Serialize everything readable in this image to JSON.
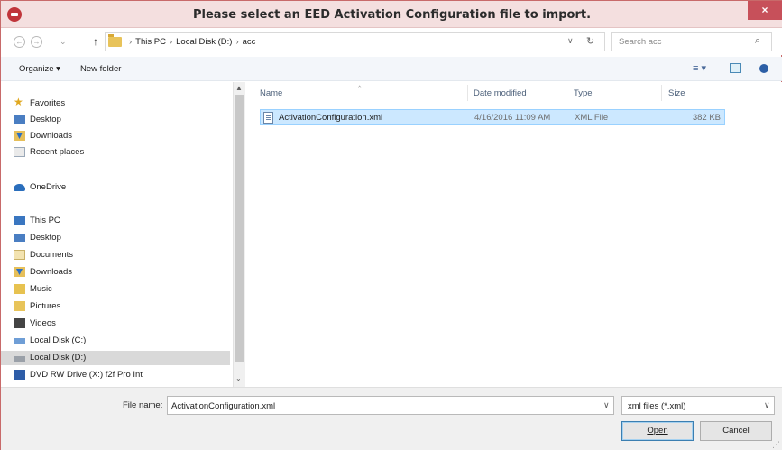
{
  "window": {
    "title": "Please select an EED Activation Configuration file to import.",
    "close_glyph": "×"
  },
  "nav": {
    "back_glyph": "←",
    "forward_glyph": "→",
    "recent_glyph": "⌄",
    "up_glyph": "↑",
    "breadcrumb": [
      "This PC",
      "Local Disk (D:)",
      "acc"
    ],
    "address_dropdown_glyph": "∨",
    "refresh_glyph": "↻",
    "search_placeholder": "Search acc",
    "search_glyph": "⌕"
  },
  "toolbar": {
    "organize_label": "Organize ▾",
    "new_folder_label": "New folder",
    "view_glyph": "≡ ▾"
  },
  "sidebar": {
    "favorites": {
      "label": "Favorites",
      "icon": "star-icon"
    },
    "favorite_items": [
      {
        "label": "Desktop",
        "icon": "desktop-icon"
      },
      {
        "label": "Downloads",
        "icon": "downloads-icon"
      },
      {
        "label": "Recent places",
        "icon": "recent-places-icon"
      }
    ],
    "onedrive": {
      "label": "OneDrive",
      "icon": "onedrive-icon"
    },
    "thispc": {
      "label": "This PC",
      "icon": "computer-icon"
    },
    "pc_items": [
      {
        "label": "Desktop",
        "icon": "desktop-icon"
      },
      {
        "label": "Documents",
        "icon": "documents-icon"
      },
      {
        "label": "Downloads",
        "icon": "downloads-icon"
      },
      {
        "label": "Music",
        "icon": "music-icon"
      },
      {
        "label": "Pictures",
        "icon": "pictures-icon"
      },
      {
        "label": "Videos",
        "icon": "videos-icon"
      },
      {
        "label": "Local Disk (C:)",
        "icon": "drive-icon"
      },
      {
        "label": "Local Disk (D:)",
        "icon": "drive-icon",
        "selected": true
      },
      {
        "label": "DVD RW Drive (X:) f2f Pro Int",
        "icon": "dvd-drive-icon"
      }
    ],
    "scroll_up_glyph": "▲",
    "scroll_down_glyph": "⌄"
  },
  "columns": {
    "name": "Name",
    "date_modified": "Date modified",
    "type": "Type",
    "size": "Size",
    "sort_glyph": "^"
  },
  "files": [
    {
      "name": "ActivationConfiguration.xml",
      "date_modified": "4/16/2016 11:09 AM",
      "type": "XML File",
      "size": "382 KB",
      "selected": true
    }
  ],
  "footer": {
    "file_name_label": "File name:",
    "file_name_value": "ActivationConfiguration.xml",
    "file_name_dropdown_glyph": "∨",
    "filter_value": "xml files (*.xml)",
    "filter_dropdown_glyph": "∨",
    "open_label": "Open",
    "cancel_label": "Cancel",
    "grip_glyph": "⋰"
  },
  "colors": {
    "titlebar": "#f4dfdf",
    "close_button": "#c7505a",
    "selection": "#cce8ff",
    "selection_border": "#99d1ff",
    "footer": "#f0f0f0"
  }
}
